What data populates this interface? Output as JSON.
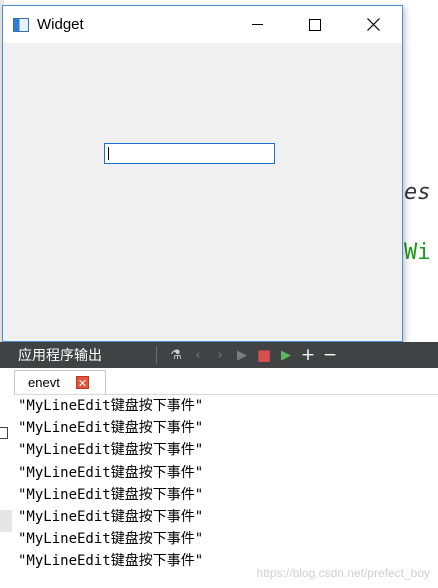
{
  "editor": {
    "fragment_1": "es",
    "fragment_2": "Wi"
  },
  "window": {
    "title": "Widget",
    "icon": "app-window-icon",
    "controls": [
      "minimize-icon",
      "maximize-icon",
      "close-icon"
    ],
    "line_edit_value": ""
  },
  "output_panel": {
    "title": "应用程序输出",
    "toolbar_icons": [
      "attach-debugger-icon",
      "prev-icon",
      "next-icon",
      "run-icon",
      "stop-icon",
      "debug-run-icon",
      "zoom-in-icon",
      "zoom-out-icon"
    ],
    "tab_label": "enevt",
    "lines": [
      "\"MyLineEdit键盘按下事件\"",
      "\"MyLineEdit键盘按下事件\"",
      "\"MyLineEdit键盘按下事件\"",
      "\"MyLineEdit键盘按下事件\"",
      "\"MyLineEdit键盘按下事件\"",
      "\"MyLineEdit键盘按下事件\"",
      "\"MyLineEdit键盘按下事件\"",
      "\"MyLineEdit键盘按下事件\""
    ]
  },
  "watermark": "https://blog.csdn.net/prefect_boy",
  "colors": {
    "window_border": "#4a90d9",
    "toolbar_bg": "#404244",
    "stop": "#d94f4f",
    "tab_close": "#e2533a"
  }
}
